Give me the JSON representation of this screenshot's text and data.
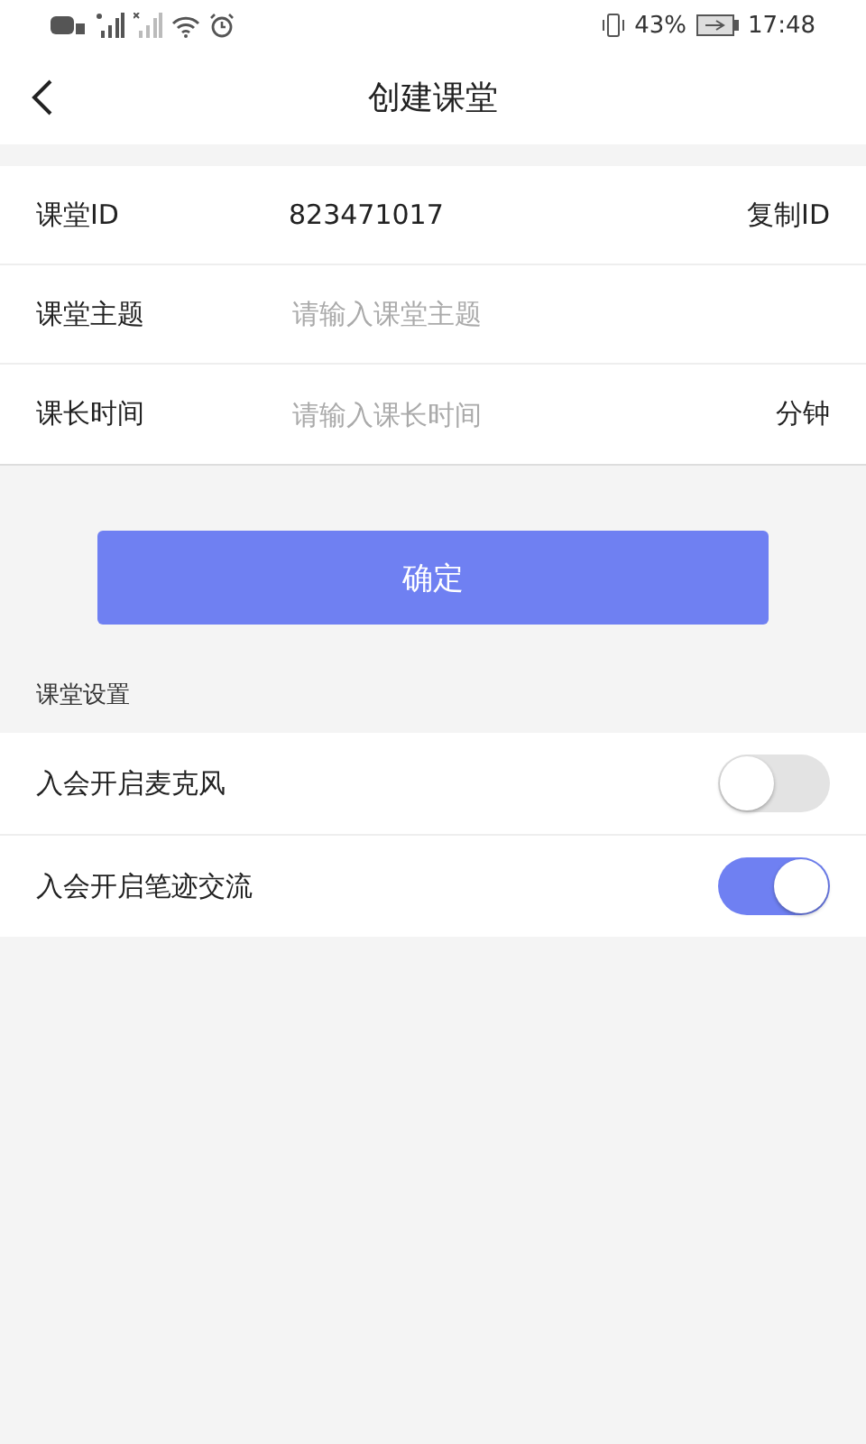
{
  "status_bar": {
    "battery": "43%",
    "time": "17:48"
  },
  "header": {
    "title": "创建课堂"
  },
  "form": {
    "class_id": {
      "label": "课堂ID",
      "value": "823471017",
      "action": "复制ID"
    },
    "topic": {
      "label": "课堂主题",
      "placeholder": "请输入课堂主题"
    },
    "duration": {
      "label": "课长时间",
      "placeholder": "请输入课长时间",
      "unit": "分钟"
    }
  },
  "confirm_button": "确定",
  "settings": {
    "title": "课堂设置",
    "items": [
      {
        "label": "入会开启麦克风",
        "on": false
      },
      {
        "label": "入会开启笔迹交流",
        "on": true
      }
    ]
  }
}
